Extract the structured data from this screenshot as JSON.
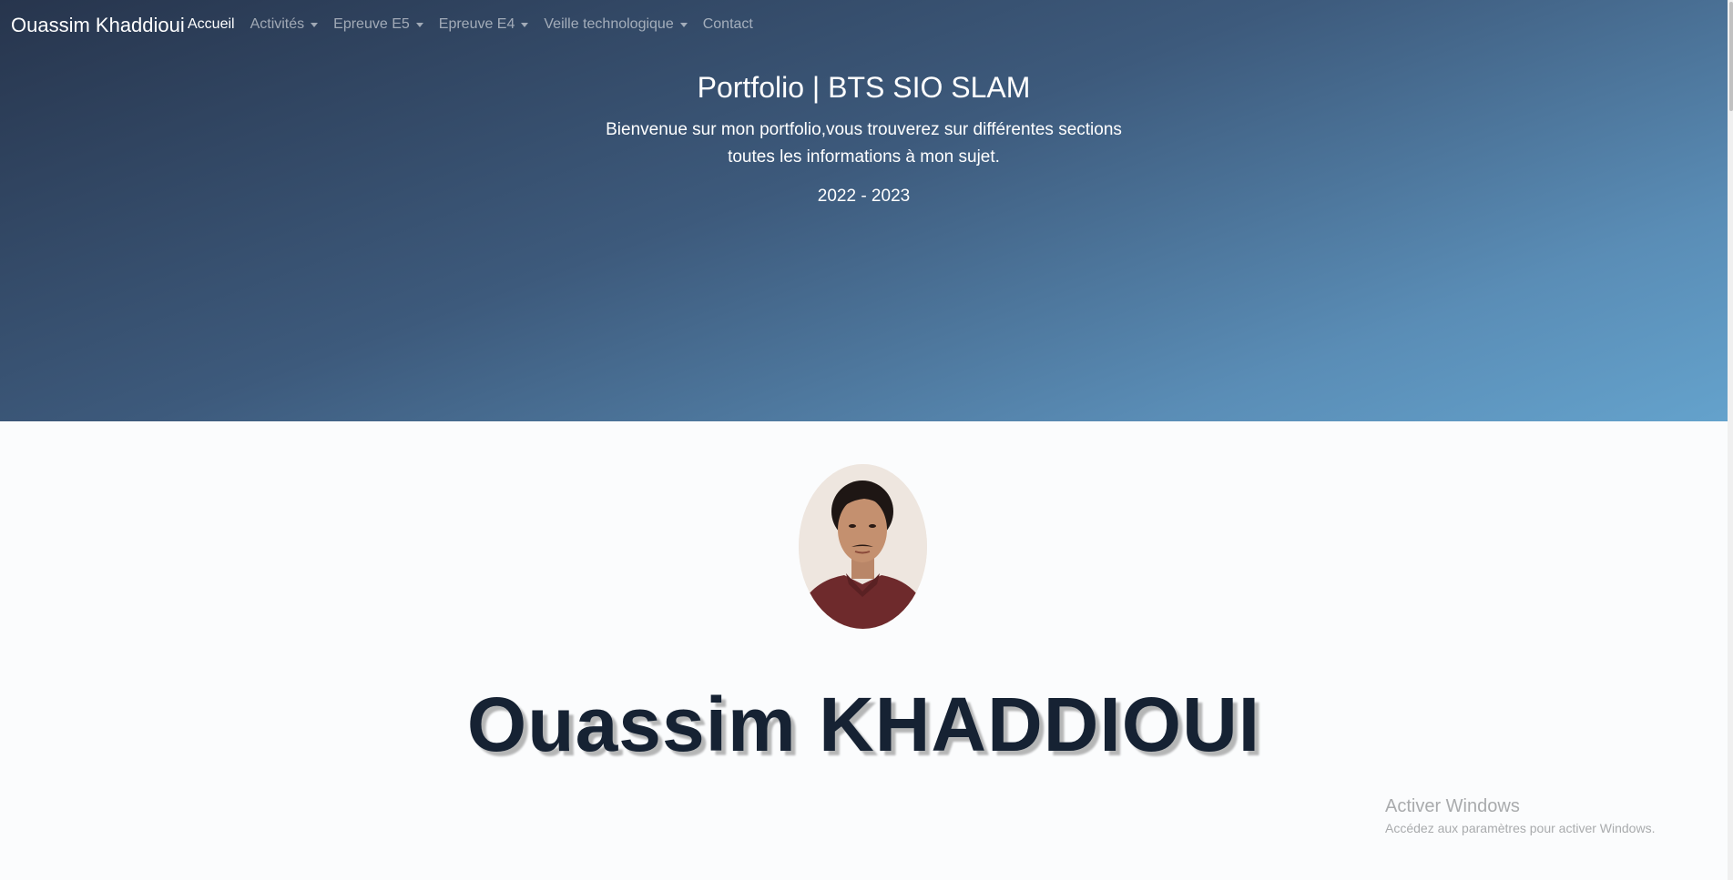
{
  "navbar": {
    "brand": "Ouassim Khaddioui",
    "items": [
      {
        "label": "Accueil",
        "active": true,
        "dropdown": false
      },
      {
        "label": "Activités",
        "active": false,
        "dropdown": true
      },
      {
        "label": "Epreuve E5",
        "active": false,
        "dropdown": true
      },
      {
        "label": "Epreuve E4",
        "active": false,
        "dropdown": true
      },
      {
        "label": "Veille technologique",
        "active": false,
        "dropdown": true
      },
      {
        "label": "Contact",
        "active": false,
        "dropdown": false
      }
    ]
  },
  "hero": {
    "title": "Portfolio | BTS SIO SLAM",
    "subtitle_line1": "Bienvenue sur mon portfolio,vous trouverez sur différentes sections",
    "subtitle_line2": "toutes les informations à mon sujet.",
    "years": "2022 - 2023"
  },
  "profile": {
    "name": "Ouassim KHADDIOUI"
  },
  "watermark": {
    "title": "Activer Windows",
    "subtitle": "Accédez aux paramètres pour activer Windows."
  },
  "colors": {
    "hero_gradient_start": "#27354d",
    "hero_gradient_end": "#64a2cc",
    "name_color": "#162233"
  }
}
